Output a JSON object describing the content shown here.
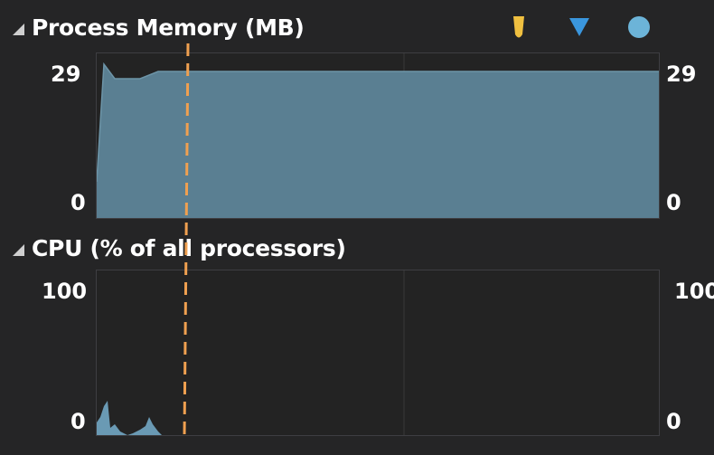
{
  "memory_panel": {
    "title": "Process Memory (MB)",
    "y_max_left": "29",
    "y_min_left": "0",
    "y_max_right": "29",
    "y_min_right": "0",
    "fill_color": "#5a7f92"
  },
  "cpu_panel": {
    "title": "CPU (% of all processors)",
    "y_max_left": "100",
    "y_min_left": "0",
    "y_max_right": "100",
    "y_min_right": "0",
    "fill_color": "#6a9ab4"
  },
  "legend": {
    "snapshot_color": "#f0c040",
    "gc_color": "#3a96dd",
    "event_color": "#6cb4d8"
  },
  "marker": {
    "color": "#f0a050"
  }
}
